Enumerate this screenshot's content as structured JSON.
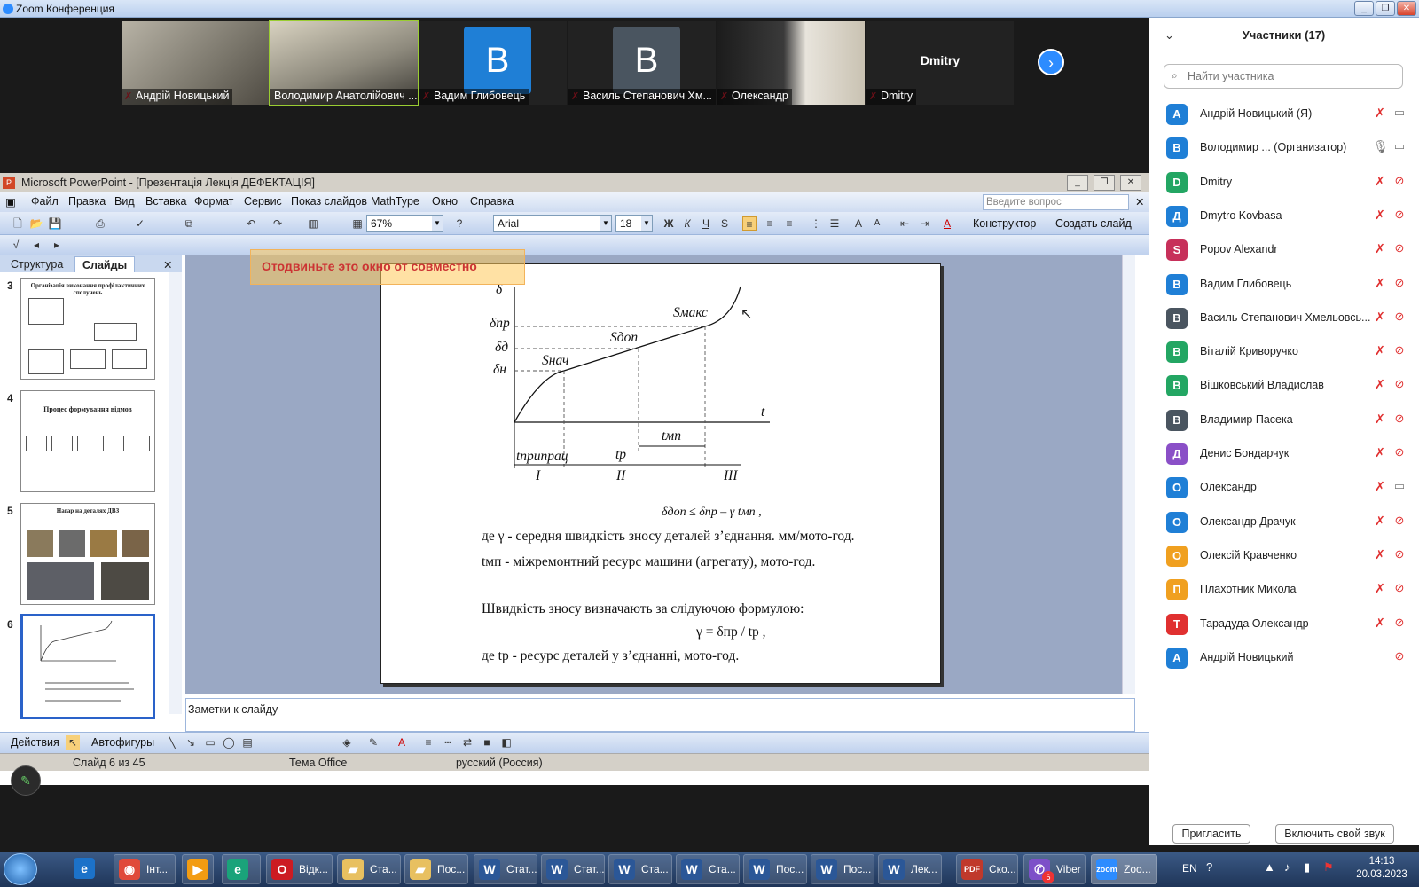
{
  "zoom": {
    "title": "Zoom Конференция",
    "participants_header": "Участники (17)",
    "search_placeholder": "Найти участника",
    "invite_label": "Пригласить",
    "unmute_label": "Включить свой звук",
    "tiles": [
      {
        "name": "Андрій Новицький"
      },
      {
        "name": "Володимир Анатолійович ..."
      },
      {
        "name": "Вадим Глибовець",
        "avatar": "B"
      },
      {
        "name": "Василь Степанович Хм...",
        "avatar": "B"
      },
      {
        "name": "Олександр"
      },
      {
        "name": "Dmitry",
        "big": "Dmitry"
      }
    ],
    "participants": [
      {
        "initial": "A",
        "name": "Андрій Новицький (Я)",
        "color": "#1f7fd6",
        "mic": "muted",
        "cam": "on"
      },
      {
        "initial": "B",
        "name": "Володимир ...  (Организатор)",
        "color": "#1f7fd6",
        "mic": "on",
        "cam": "on"
      },
      {
        "initial": "D",
        "name": "Dmitry",
        "color": "#23a663",
        "mic": "muted",
        "cam": "off"
      },
      {
        "initial": "Д",
        "name": "Dmytro Kovbasa",
        "color": "#1f7fd6",
        "mic": "muted",
        "cam": "off"
      },
      {
        "initial": "S",
        "name": "Popov Alexandr",
        "color": "#c7305a",
        "mic": "muted",
        "cam": "off"
      },
      {
        "initial": "B",
        "name": "Вадим Глибовець",
        "color": "#1f7fd6",
        "mic": "muted",
        "cam": "off"
      },
      {
        "initial": "B",
        "name": "Василь Степанович Хмельовсь...",
        "color": "#4a5560",
        "mic": "muted",
        "cam": "off"
      },
      {
        "initial": "B",
        "name": "Віталій Криворучко",
        "color": "#23a663",
        "mic": "muted",
        "cam": "off"
      },
      {
        "initial": "B",
        "name": "Вішковський Владислав",
        "color": "#23a663",
        "mic": "muted",
        "cam": "off"
      },
      {
        "initial": "B",
        "name": "Владимир Пасека",
        "color": "#4a5560",
        "mic": "muted",
        "cam": "off"
      },
      {
        "initial": "Д",
        "name": "Денис Бондарчук",
        "color": "#8a4fc7",
        "mic": "muted",
        "cam": "off"
      },
      {
        "initial": "O",
        "name": "Олександр",
        "color": "#1f7fd6",
        "mic": "muted",
        "cam": "on"
      },
      {
        "initial": "O",
        "name": "Олександр Драчук",
        "color": "#1f7fd6",
        "mic": "muted",
        "cam": "off"
      },
      {
        "initial": "O",
        "name": "Олексій Кравченко",
        "color": "#f0a020",
        "mic": "muted",
        "cam": "off"
      },
      {
        "initial": "П",
        "name": "Плахотник Микола",
        "color": "#f0a020",
        "mic": "muted",
        "cam": "off"
      },
      {
        "initial": "T",
        "name": "Тарадуда Олександр",
        "color": "#e03030",
        "mic": "muted",
        "cam": "off"
      },
      {
        "initial": "A",
        "name": "Андрій Новицький",
        "color": "#1f7fd6",
        "mic": "none",
        "cam": "off"
      }
    ]
  },
  "ppt": {
    "title": "Microsoft PowerPoint - [Презентація  Лекція ДЕФЕКТАЦІЯ]",
    "menu": [
      "Файл",
      "Правка",
      "Вид",
      "Вставка",
      "Формат",
      "Сервис",
      "Показ слайдов",
      "MathType",
      "Окно",
      "Справка"
    ],
    "ask_placeholder": "Введите вопрос",
    "zoom": "67%",
    "font": "Arial",
    "font_size": "18",
    "designer": "Конструктор",
    "new_slide": "Создать слайд",
    "tab_structure": "Структура",
    "tab_slides": "Слайды",
    "thumbs": [
      {
        "num": "3",
        "title": "Організація виконання профілактичних сполучень"
      },
      {
        "num": "4",
        "title": "Процес формування відмов"
      },
      {
        "num": "5",
        "title": "Нагар на деталях ДВЗ"
      },
      {
        "num": "6",
        "title": ""
      }
    ],
    "drag_hint": "Отодвиньте это окно от совместно",
    "notes": "Заметки к слайду",
    "actions": "Действия",
    "autoshapes": "Автофигуры",
    "status_slide": "Слайд 6 из 45",
    "status_theme": "Тема Office",
    "status_lang": "русский (Россия)",
    "slide": {
      "axis_y": "δ",
      "axis_x": "t",
      "labels": {
        "dpr": "δпр",
        "dd": "δд",
        "dn": "δн",
        "snach": "Sнач",
        "sdop": "Sдоп",
        "smaks": "Sмакс",
        "tmp": "tмп",
        "tpryprats": "tприпрац",
        "tr": "tр",
        "I": "I",
        "II": "II",
        "III": "III"
      },
      "formula1": "δдоп ≤ δпр – γ tмп ,",
      "line1": "де γ - середня швидкість зносу деталей з’єднання. мм/мото-год.",
      "line2": "tмп - міжремонтний ресурс машини (агрегату), мото-год.",
      "line3": "Швидкість зносу визначають за слідуючою формулою:",
      "formula2": "γ = δпр / tр ,",
      "line4": "де tр - ресурс деталей у з’єднанні, мото-год."
    }
  },
  "taskbar": {
    "items": [
      "Інт...",
      "",
      "",
      "Відк...",
      "Ста...",
      "Пос...",
      "Стат...",
      "Стат...",
      "Ста...",
      "Ста...",
      "Пос...",
      "Пос...",
      "Лек...",
      "Ско...",
      "Viber",
      "Zoo..."
    ],
    "lang": "EN",
    "time": "14:13",
    "date": "20.03.2023",
    "viber_badge": "6"
  }
}
